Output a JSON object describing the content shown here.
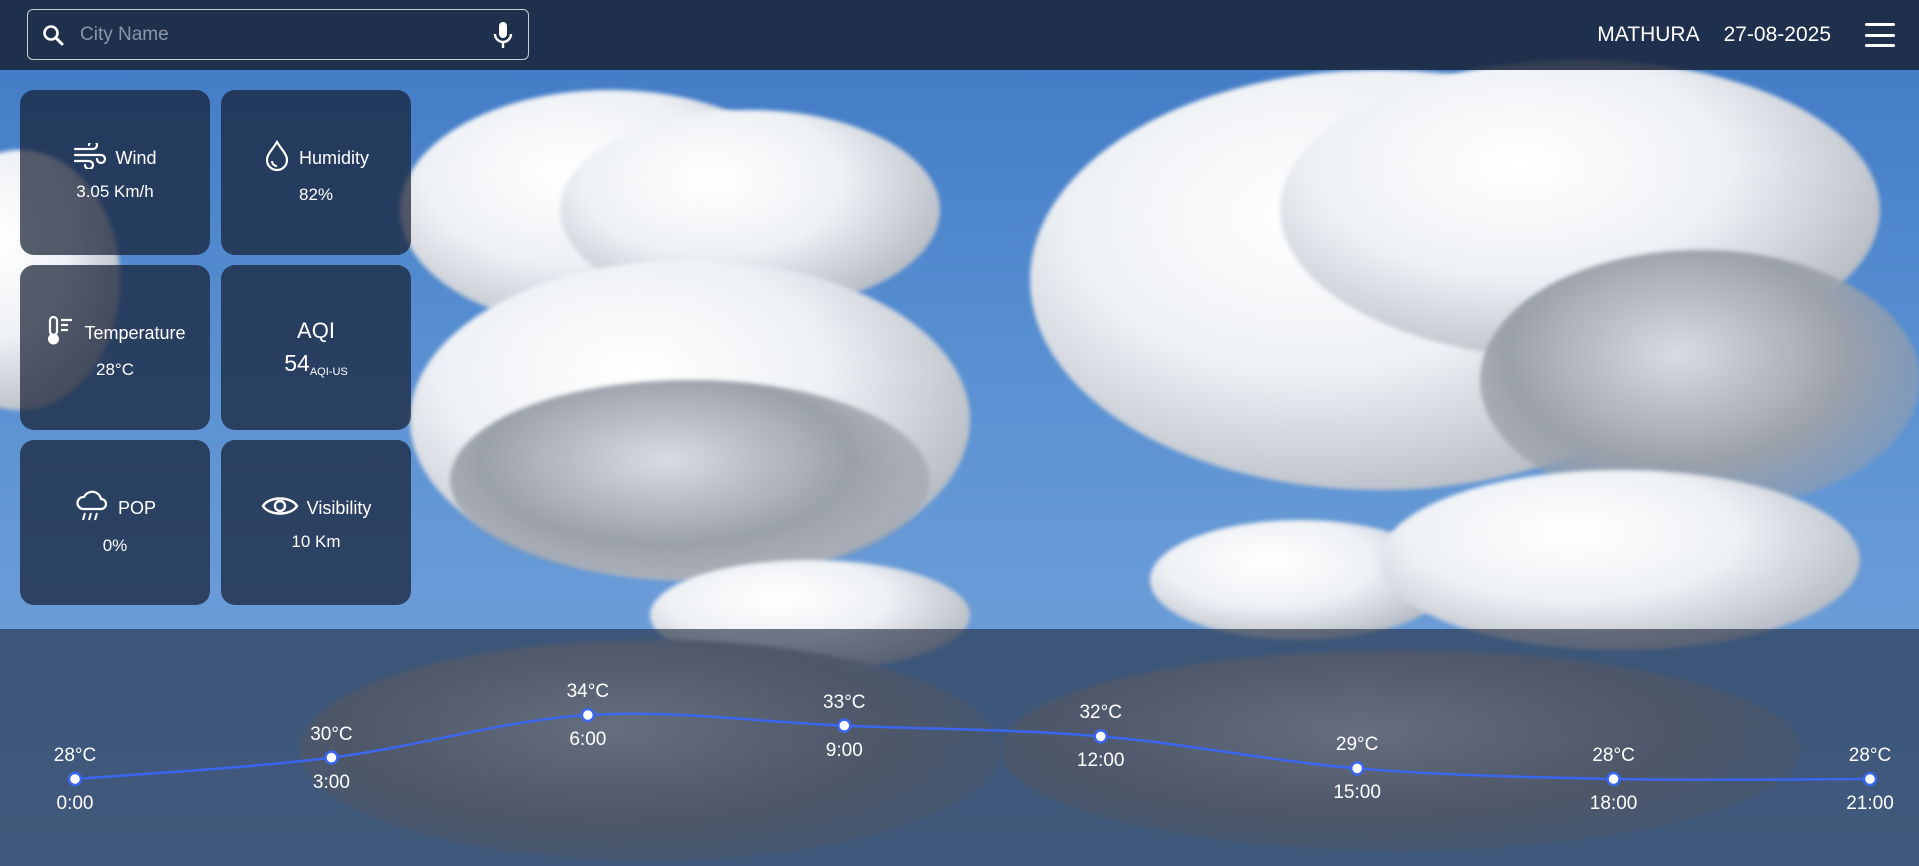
{
  "search": {
    "placeholder": "City Name"
  },
  "header": {
    "city": "MATHURA",
    "date": "27-08-2025"
  },
  "cards": {
    "wind": {
      "label": "Wind",
      "value": "3.05 Km/h"
    },
    "humidity": {
      "label": "Humidity",
      "value": "82%"
    },
    "temperature": {
      "label": "Temperature",
      "value": "28°C"
    },
    "aqi": {
      "label": "AQI",
      "value": "54",
      "unit": "AQI-US"
    },
    "pop": {
      "label": "POP",
      "value": "0%"
    },
    "visibility": {
      "label": "Visibility",
      "value": "10 Km"
    }
  },
  "chart_data": {
    "type": "line",
    "x": [
      "0:00",
      "3:00",
      "6:00",
      "9:00",
      "12:00",
      "15:00",
      "18:00",
      "21:00"
    ],
    "series": [
      {
        "values": [
          28,
          30,
          34,
          33,
          32,
          29,
          28,
          28
        ]
      }
    ],
    "value_labels": [
      "28°C",
      "30°C",
      "34°C",
      "33°C",
      "32°C",
      "29°C",
      "28°C",
      "28°C"
    ],
    "line_color": "#3b66f0"
  }
}
